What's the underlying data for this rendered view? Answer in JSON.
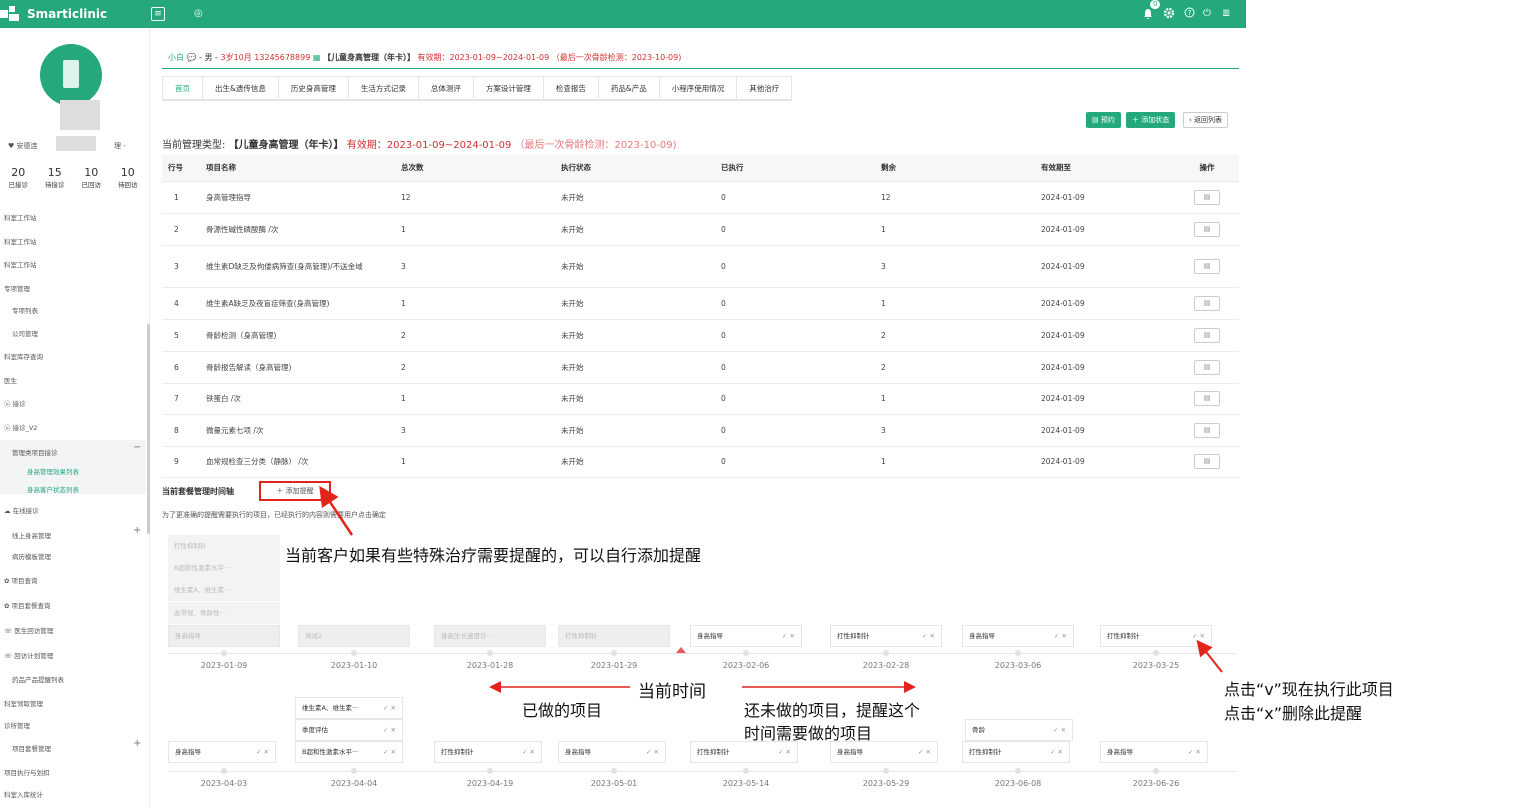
{
  "topbar": {
    "brand": "Smarticlinic",
    "menu_icon": "≡",
    "circle_icon": "◎",
    "notification_count": "0",
    "bell_icon": "bell",
    "gear_icon": "gear",
    "help_icon": "?",
    "power_icon": "⏻",
    "more_icon": "≣"
  },
  "sidebar": {
    "location_left": "♥ 安德连",
    "location_right": "理 -",
    "stats": [
      {
        "value": "20",
        "label": "已接诊"
      },
      {
        "value": "15",
        "label": "待接诊"
      },
      {
        "value": "10",
        "label": "已回访"
      },
      {
        "value": "10",
        "label": "待回访"
      }
    ],
    "menu": [
      {
        "label": "科室工作站",
        "type": "top"
      },
      {
        "label": "科室工作站",
        "type": "top"
      },
      {
        "label": "科室工作站",
        "type": "top"
      },
      {
        "label": "专项管理",
        "type": "top"
      },
      {
        "label": "专项列表",
        "type": "ind"
      },
      {
        "label": "公司管理",
        "type": "ind"
      },
      {
        "label": "科室库存查询",
        "type": "top"
      },
      {
        "label": "医生",
        "type": "top"
      },
      {
        "label": "ⓤ  接诊",
        "type": "top"
      },
      {
        "label": "ⓤ  接诊_V2",
        "type": "top"
      },
      {
        "label": "管理类项目接诊",
        "type": "ind"
      },
      {
        "label": "身高管理效果列表",
        "type": "act"
      },
      {
        "label": "身高客户状态列表",
        "type": "act"
      },
      {
        "label": "☁  在线接诊",
        "type": "top"
      },
      {
        "label": "线上身高管理",
        "type": "ind"
      },
      {
        "label": "病历模板管理",
        "type": "ind"
      },
      {
        "label": "✿  项目查询",
        "type": "top"
      },
      {
        "label": "✿  项目套餐查询",
        "type": "top"
      },
      {
        "label": "☏  医生回访管理",
        "type": "top"
      },
      {
        "label": "☏  回访计划管理",
        "type": "top"
      },
      {
        "label": "药品产品提醒列表",
        "type": "ind"
      },
      {
        "label": "科室领取管理",
        "type": "top"
      },
      {
        "label": "诊所管理",
        "type": "top"
      },
      {
        "label": "项目套餐管理",
        "type": "ind"
      },
      {
        "label": "项目执行与划扣",
        "type": "top"
      },
      {
        "label": "科室入库统计",
        "type": "top"
      }
    ],
    "collapse_symbol": "−",
    "expand_symbol": "+"
  },
  "patient": {
    "name": "小白",
    "sep1": "-",
    "gender": "男 -",
    "age_phone": "3岁10月 13245678899",
    "card_icon": "▦",
    "plan": "【儿童身高管理（年卡）】",
    "validity": "有效期：2023-01-09~2024-01-09 （最后一次骨龄检测：2023-10-09)"
  },
  "tabs": [
    "首页",
    "出生&遗传信息",
    "历史身高管理",
    "生活方式记录",
    "总体测评",
    "方案设计管理",
    "检查报告",
    "药品&产品",
    "小程序使用情况",
    "其他治疗"
  ],
  "actions": {
    "appointment": "▤ 预约",
    "add_status": "＋ 添加状态",
    "back": "‹ 返回列表"
  },
  "management": {
    "label": "当前管理类型:",
    "plan": "【儿童身高管理（年卡）】",
    "validity": "有效期：2023-01-09~2024-01-09",
    "last_check": "（最后一次骨龄检测：2023-10-09)"
  },
  "table": {
    "headers": [
      "行号",
      "项目名称",
      "总次数",
      "执行状态",
      "已执行",
      "剩余",
      "有效期至",
      "操作"
    ],
    "rows": [
      {
        "no": "1",
        "name": "身高管理指导",
        "total": "12",
        "status": "未开始",
        "done": "0",
        "left": "12",
        "expire": "2024-01-09"
      },
      {
        "no": "2",
        "name": "骨源性碱性磷酸酶 /次",
        "total": "1",
        "status": "未开始",
        "done": "0",
        "left": "1",
        "expire": "2024-01-09"
      },
      {
        "no": "3",
        "name": "维生素D缺乏及佝偻病筛查(身高管理)/不送金域",
        "total": "3",
        "status": "未开始",
        "done": "0",
        "left": "3",
        "expire": "2024-01-09"
      },
      {
        "no": "4",
        "name": "维生素A缺乏及夜盲症筛查(身高管理)",
        "total": "1",
        "status": "未开始",
        "done": "0",
        "left": "1",
        "expire": "2024-01-09"
      },
      {
        "no": "5",
        "name": "骨龄检测（身高管理)",
        "total": "2",
        "status": "未开始",
        "done": "0",
        "left": "2",
        "expire": "2024-01-09"
      },
      {
        "no": "6",
        "name": "骨龄报告解读（身高管理)",
        "total": "2",
        "status": "未开始",
        "done": "0",
        "left": "2",
        "expire": "2024-01-09"
      },
      {
        "no": "7",
        "name": "铁蛋白 /次",
        "total": "1",
        "status": "未开始",
        "done": "0",
        "left": "1",
        "expire": "2024-01-09"
      },
      {
        "no": "8",
        "name": "微量元素七项 /次",
        "total": "3",
        "status": "未开始",
        "done": "0",
        "left": "3",
        "expire": "2024-01-09"
      },
      {
        "no": "9",
        "name": "血常规检查三分类（静脉） /次",
        "total": "1",
        "status": "未开始",
        "done": "0",
        "left": "1",
        "expire": "2024-01-09"
      }
    ],
    "op_icon": "▤"
  },
  "timeline": {
    "title": "当前套餐管理时间轴",
    "add_button": "＋ 添加提醒",
    "note": "为了更准确的提醒需要执行的项目，已经执行的内容则需要用户点击确定",
    "pending": [
      "打性抑制针",
      "B超和性激素水平···",
      "维生素A、维生素···",
      "血常规、骨龄性···"
    ],
    "row1": [
      {
        "label": "身高指导",
        "date": "2023-01-09",
        "state": "done"
      },
      {
        "label": "测试2",
        "date": "2023-01-10",
        "state": "done"
      },
      {
        "label": "身高生长速度诊···",
        "date": "2023-01-28",
        "state": "done"
      },
      {
        "label": "打性抑制针",
        "date": "2023-01-29",
        "state": "done"
      },
      {
        "label": "身高指导",
        "date": "2023-02-06",
        "state": "todo"
      },
      {
        "label": "打性抑制针",
        "date": "2023-02-28",
        "state": "todo"
      },
      {
        "label": "身高指导",
        "date": "2023-03-06",
        "state": "todo"
      },
      {
        "label": "打性抑制针",
        "date": "2023-03-25",
        "state": "todo"
      }
    ],
    "row2": [
      {
        "label": "身高指导",
        "date": "2023-04-03"
      },
      {
        "label": "B超和性激素水平···",
        "date": "2023-04-04"
      },
      {
        "label": "打性抑制针",
        "date": "2023-04-19"
      },
      {
        "label": "身高指导",
        "date": "2023-05-01"
      },
      {
        "label": "打性抑制针",
        "date": "2023-05-14"
      },
      {
        "label": "身高指导",
        "date": "2023-05-29"
      },
      {
        "label": "打性抑制针",
        "date": "2023-06-08"
      },
      {
        "label": "身高指导",
        "date": "2023-06-26"
      }
    ],
    "stack_0404": [
      "维生素A、维生素···",
      "季度评估"
    ],
    "stack_0608": [
      "骨龄"
    ],
    "acts": "✓ ✕"
  },
  "annotations": {
    "add_reminder": "当前客户如果有些特殊治疗需要提醒的，可以自行添加提醒",
    "now": "当前时间",
    "done": "已做的项目",
    "todo_line1": "还未做的项目，提醒这个",
    "todo_line2": "时间需要做的项目",
    "click_v": "点击“v”现在执行此项目",
    "click_x": "点击“x”删除此提醒",
    "arrow_color": "#e1251b"
  }
}
